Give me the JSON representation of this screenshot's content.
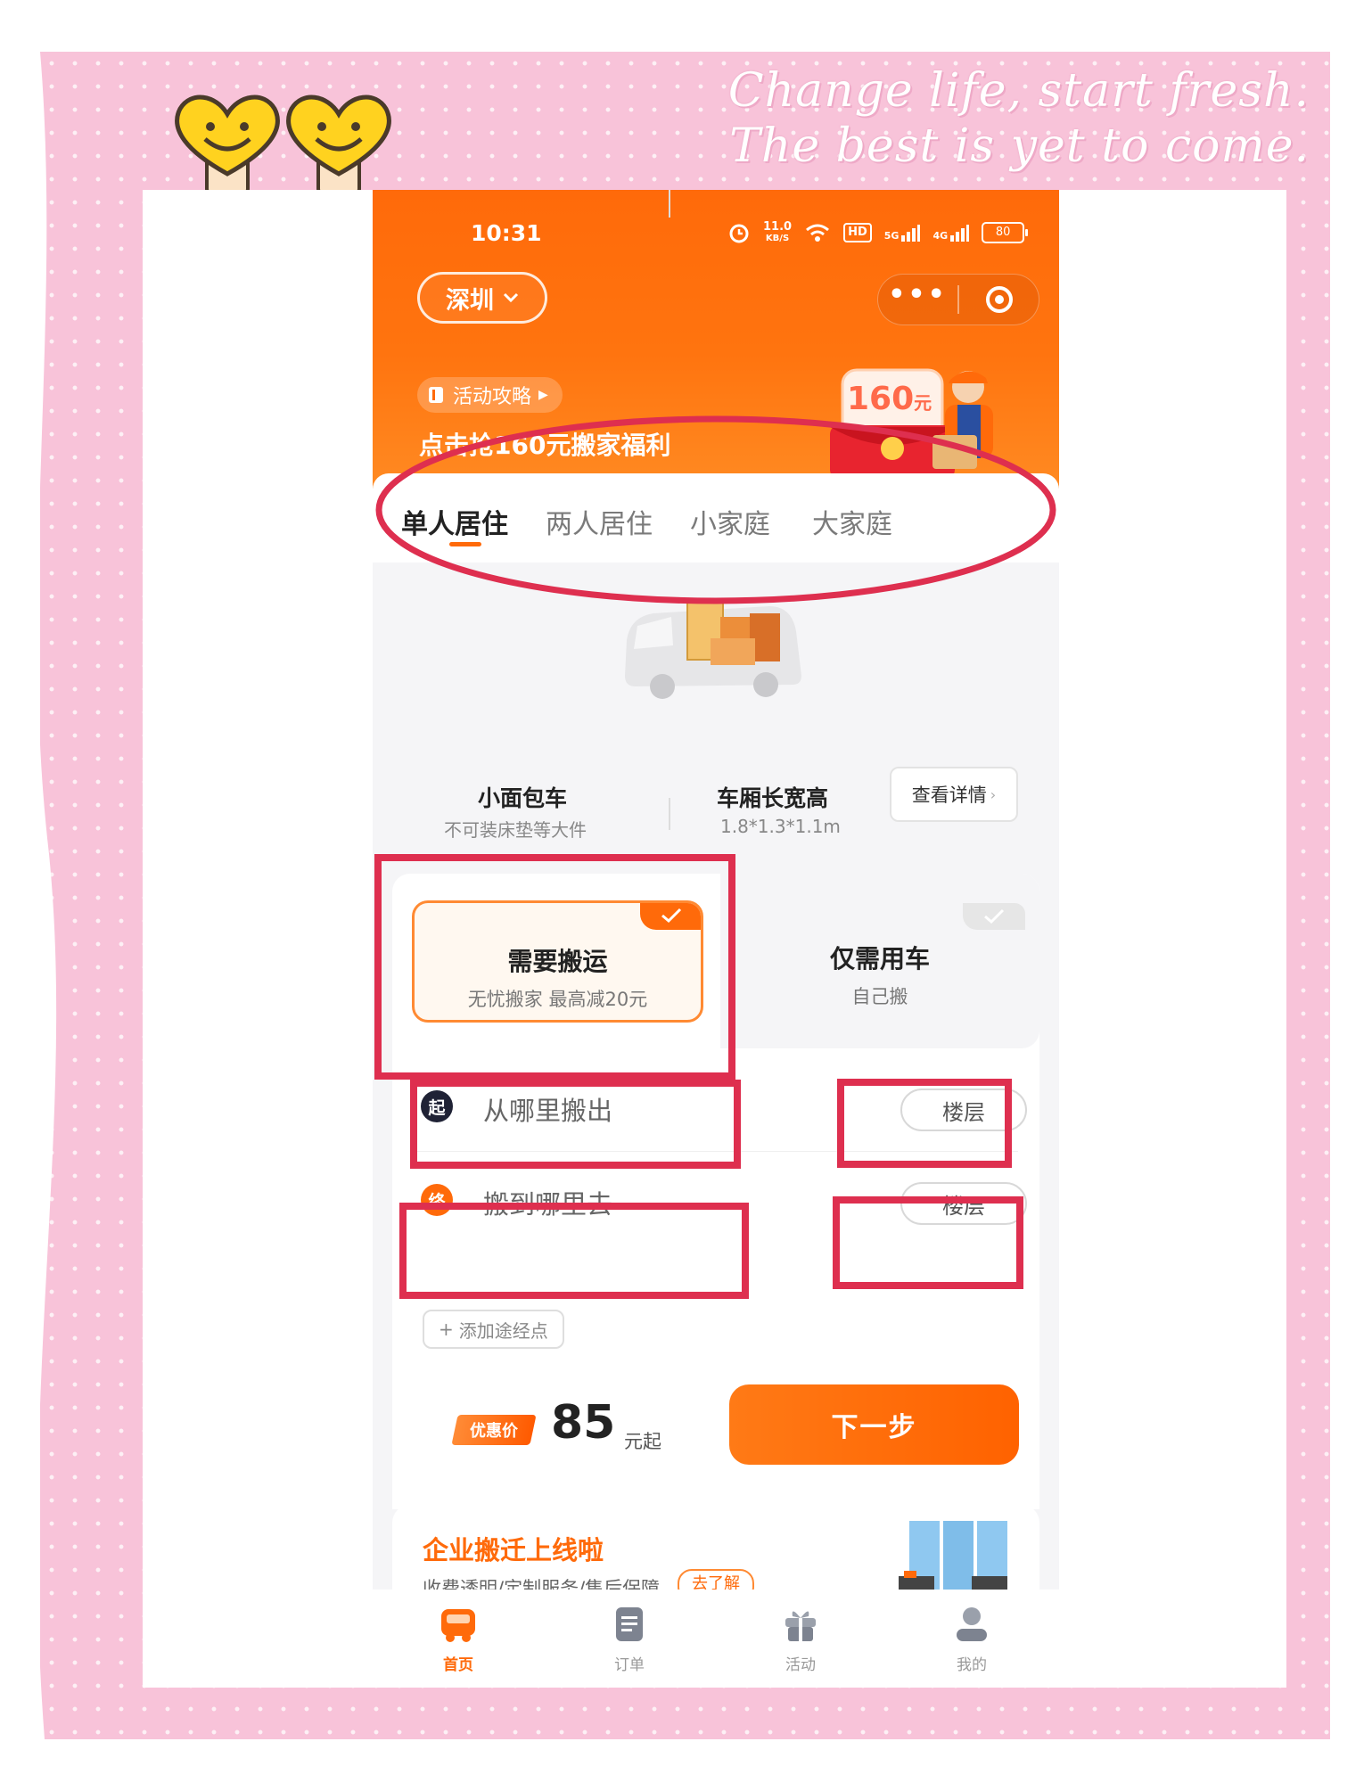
{
  "decor": {
    "slogan_line1": "Change life, start fresh.",
    "slogan_line2": "The best is yet to come.",
    "frame_color": "#f8c3d9",
    "annotation_color": "#de2f4f"
  },
  "status_bar": {
    "time": "10:31",
    "net_speed_value": "11.0",
    "net_speed_unit": "KB/S",
    "hd_label": "HD",
    "sim1_label": "5G",
    "sim2_label": "4G",
    "battery": "80"
  },
  "header": {
    "city": "深圳",
    "more_icon": "more-dots-icon",
    "target_icon": "target-icon",
    "promo_pill_label": "活动攻略",
    "promo_text": "点击抢160元搬家福利",
    "envelope_amount": "160",
    "envelope_unit": "元"
  },
  "tabs": [
    {
      "label": "单人居住",
      "active": true
    },
    {
      "label": "两人居住",
      "active": false
    },
    {
      "label": "小家庭",
      "active": false
    },
    {
      "label": "大家庭",
      "active": false
    }
  ],
  "vehicle": {
    "name": "小面包车",
    "note": "不可装床垫等大件",
    "dims_label": "车厢长宽高",
    "dims_value": "1.8*1.3*1.1m",
    "details_button": "查看详情"
  },
  "service_options": [
    {
      "title": "需要搬运",
      "subtitle": "无忧搬家 最高减20元",
      "selected": true
    },
    {
      "title": "仅需用车",
      "subtitle": "自己搬",
      "selected": false
    }
  ],
  "locations": {
    "from_badge": "起",
    "from_placeholder": "从哪里搬出",
    "to_badge": "终",
    "to_placeholder": "搬到哪里去",
    "floor_label": "楼层",
    "add_waypoint": "添加途经点",
    "from_badge_color": "#1f2235",
    "to_badge_color": "#ff6a0a"
  },
  "pricing": {
    "tag": "优惠价",
    "amount": "85",
    "unit": "元起",
    "next_button": "下一步"
  },
  "enterprise_banner": {
    "title": "企业搬迁上线啦",
    "subtitle": "收费透明/定制服务/售后保障",
    "learn_more": "去了解"
  },
  "bottom_nav": [
    {
      "label": "首页",
      "icon": "truck-icon",
      "active": true
    },
    {
      "label": "订单",
      "icon": "document-icon",
      "active": false
    },
    {
      "label": "活动",
      "icon": "gift-icon",
      "active": false
    },
    {
      "label": "我的",
      "icon": "user-icon",
      "active": false
    }
  ],
  "colors": {
    "brand": "#ff6a0a",
    "selected_card_bg": "#fff8f0"
  }
}
